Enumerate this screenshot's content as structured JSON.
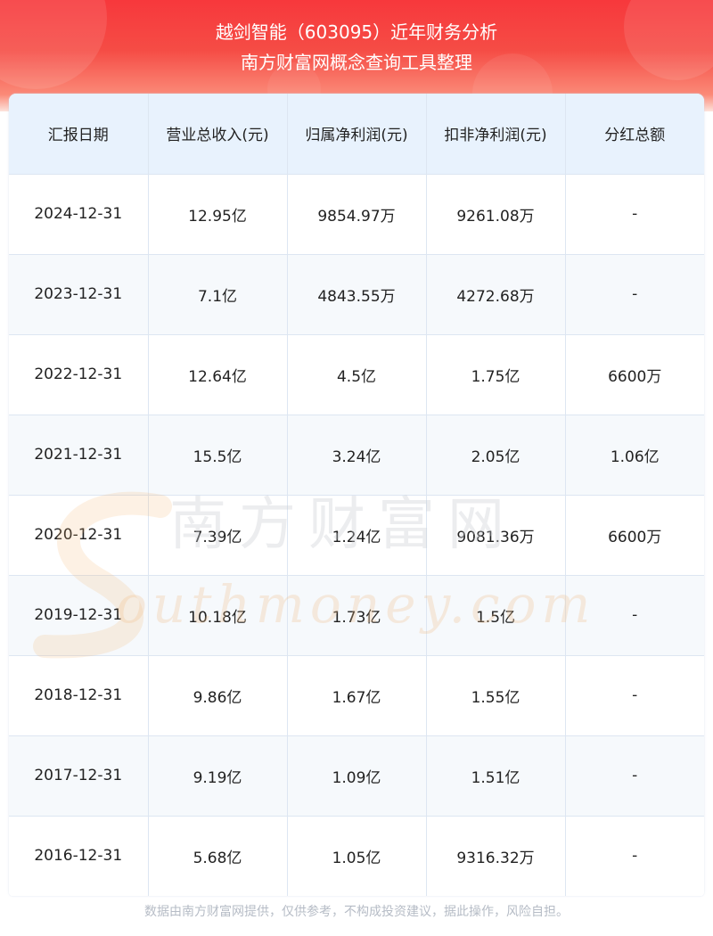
{
  "header": {
    "title_line1": "越剑智能（603095）近年财务分析",
    "title_line2": "南方财富网概念查询工具整理"
  },
  "table": {
    "columns": [
      "汇报日期",
      "营业总收入(元)",
      "归属净利润(元)",
      "扣非净利润(元)",
      "分红总额"
    ],
    "rows": [
      [
        "2024-12-31",
        "12.95亿",
        "9854.97万",
        "9261.08万",
        "-"
      ],
      [
        "2023-12-31",
        "7.1亿",
        "4843.55万",
        "4272.68万",
        "-"
      ],
      [
        "2022-12-31",
        "12.64亿",
        "4.5亿",
        "1.75亿",
        "6600万"
      ],
      [
        "2021-12-31",
        "15.5亿",
        "3.24亿",
        "2.05亿",
        "1.06亿"
      ],
      [
        "2020-12-31",
        "7.39亿",
        "1.24亿",
        "9081.36万",
        "6600万"
      ],
      [
        "2019-12-31",
        "10.18亿",
        "1.73亿",
        "1.5亿",
        "-"
      ],
      [
        "2018-12-31",
        "9.86亿",
        "1.67亿",
        "1.55亿",
        "-"
      ],
      [
        "2017-12-31",
        "9.19亿",
        "1.09亿",
        "1.51亿",
        "-"
      ],
      [
        "2016-12-31",
        "5.68亿",
        "1.05亿",
        "9316.32万",
        "-"
      ]
    ]
  },
  "watermark": {
    "cn": "南方财富网",
    "en": "outhmoney.com"
  },
  "footer": {
    "disclaimer": "数据由南方财富网提供，仅供参考，不构成投资建议，据此操作，风险自担。"
  },
  "colors": {
    "header_red": "#f7383c",
    "header_fade": "#fde3dc",
    "table_header_bg": "#e8f2fd",
    "stripe_bg": "#f6f9fc",
    "border": "#dde6f2",
    "footer_text": "#b6bcc6"
  }
}
